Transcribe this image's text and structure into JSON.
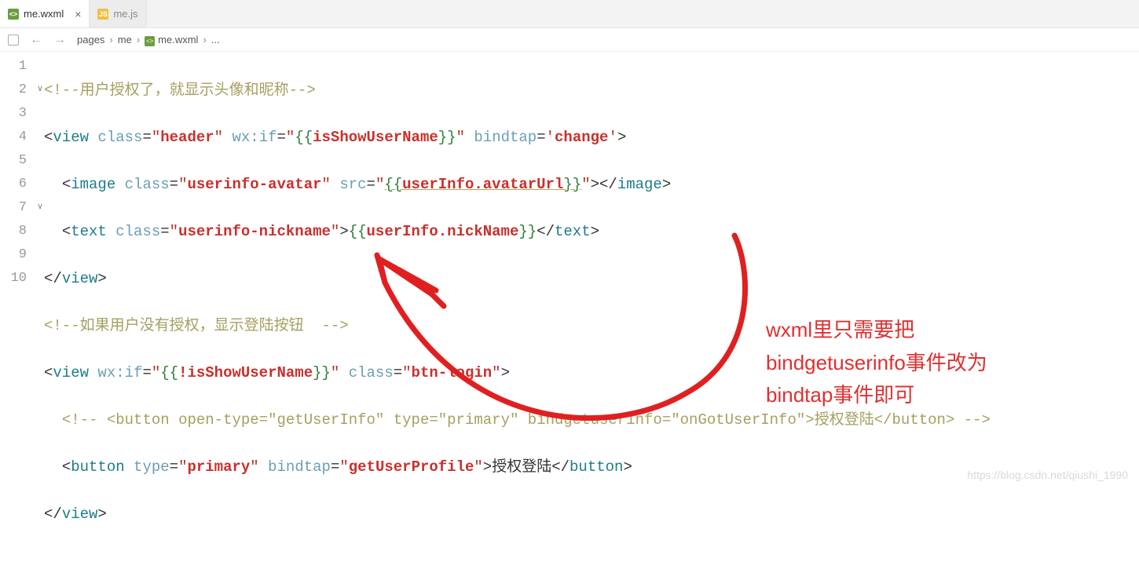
{
  "tabs": [
    {
      "label": "me.wxml",
      "icon": "wxml",
      "active": true
    },
    {
      "label": "me.js",
      "icon": "js",
      "active": false
    }
  ],
  "breadcrumb": {
    "items": [
      "pages",
      "me",
      "me.wxml",
      "..."
    ]
  },
  "lines": [
    "1",
    "2",
    "3",
    "4",
    "5",
    "6",
    "7",
    "8",
    "9",
    "10"
  ],
  "code": {
    "l1_comment": "<!--用户授权了，就显示头像和昵称-->",
    "l2": {
      "tag_open": "<",
      "tag": "view",
      "a1": "class",
      "v1": "header",
      "a2": "wx:if",
      "v2a": "{{",
      "v2b": "isShowUserName",
      "v2c": "}}",
      "a3": "bindtap",
      "v3": "change",
      "tag_close": ">"
    },
    "l3": {
      "tag_open": "<",
      "tag": "image",
      "a1": "class",
      "v1": "userinfo-avatar",
      "a2": "src",
      "v2a": "{{",
      "v2b": "userInfo.avatarUrl",
      "v2c": "}}",
      "mid": ">",
      "ctag_open": "</",
      "ctag": "image",
      "ctag_close": ">"
    },
    "l4": {
      "tag_open": "<",
      "tag": "text",
      "a1": "class",
      "v1": "userinfo-nickname",
      "mid": ">",
      "inner_a": "{{",
      "inner_b": "userInfo.nickName",
      "inner_c": "}}",
      "ctag_open": "</",
      "ctag": "text",
      "ctag_close": ">"
    },
    "l5": {
      "ctag_open": "</",
      "ctag": "view",
      "ctag_close": ">"
    },
    "l6_comment": "<!--如果用户没有授权，显示登陆按钮  -->",
    "l7": {
      "tag_open": "<",
      "tag": "view",
      "a1": "wx:if",
      "v1a": "{{",
      "v1b": "!isShowUserName",
      "v1c": "}}",
      "a2": "class",
      "v2": "btn-login",
      "tag_close": ">"
    },
    "l8": {
      "c_open": "<!-- ",
      "tag_open": "<",
      "tag": "button",
      "a1": "open-type",
      "v1": "getUserInfo",
      "a2": "type",
      "v2": "primary",
      "a3": "bindgetuserinfo",
      "v3": "onGotUserInfo",
      "mid": ">",
      "text": "授权登陆",
      "ctag_open": "</",
      "ctag": "button",
      "ctag_close": ">",
      "c_close": " -->"
    },
    "l9": {
      "tag_open": "<",
      "tag": "button",
      "a1": "type",
      "v1": "primary",
      "a2": "bindtap",
      "v2": "getUserProfile",
      "mid": ">",
      "text": "授权登陆",
      "ctag_open": "</",
      "ctag": "button",
      "ctag_close": ">"
    },
    "l10": {
      "ctag_open": "</",
      "ctag": "view",
      "ctag_close": ">"
    }
  },
  "annotation": {
    "line1": "wxml里只需要把",
    "line2": "bindgetuserinfo事件改为",
    "line3": "bindtap事件即可"
  },
  "watermark": "https://blog.csdn.net/qiushi_1990"
}
